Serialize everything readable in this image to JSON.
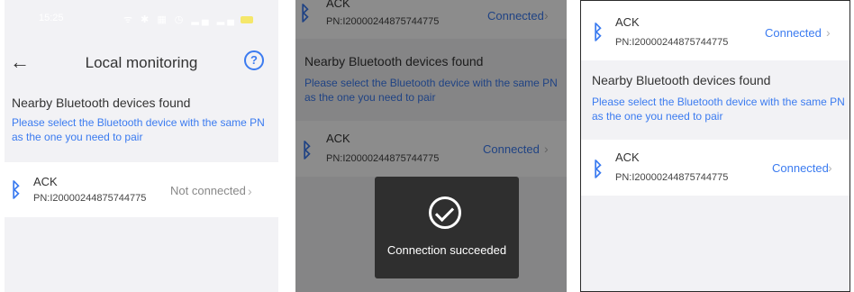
{
  "colors": {
    "accent": "#3b7bf0",
    "status_grey": "#888888"
  },
  "panel1": {
    "status_bar": {
      "time": "15:25",
      "icons": "ᯤ ✱ ▦ ◷ ▂▄ ▂▄"
    },
    "title": "Local monitoring",
    "help_icon": "?",
    "section_title": "Nearby Bluetooth devices found",
    "hint": "Please select the Bluetooth device with the same PN as the one you need to pair",
    "device": {
      "name": "ACK",
      "pn": "PN:I20000244875744775",
      "status": "Not connected",
      "icon": "bluetooth-icon"
    }
  },
  "panel2": {
    "top_device": {
      "name": "ACK",
      "pn": "PN:I20000244875744775",
      "status": "Connected"
    },
    "section_title": "Nearby Bluetooth devices found",
    "hint": "Please select the Bluetooth device with the same PN as the one you need to pair",
    "device": {
      "name": "ACK",
      "pn": "PN:I20000244875744775",
      "status": "Connected"
    },
    "toast": "Connection succeeded"
  },
  "panel3": {
    "top_device": {
      "name": "ACK",
      "pn": "PN:I20000244875744775",
      "status": "Connected"
    },
    "section_title": "Nearby Bluetooth devices found",
    "hint": "Please select the Bluetooth device with the same PN as the one you need to pair",
    "device": {
      "name": "ACK",
      "pn": "PN:I20000244875744775",
      "status": "Connected"
    }
  }
}
